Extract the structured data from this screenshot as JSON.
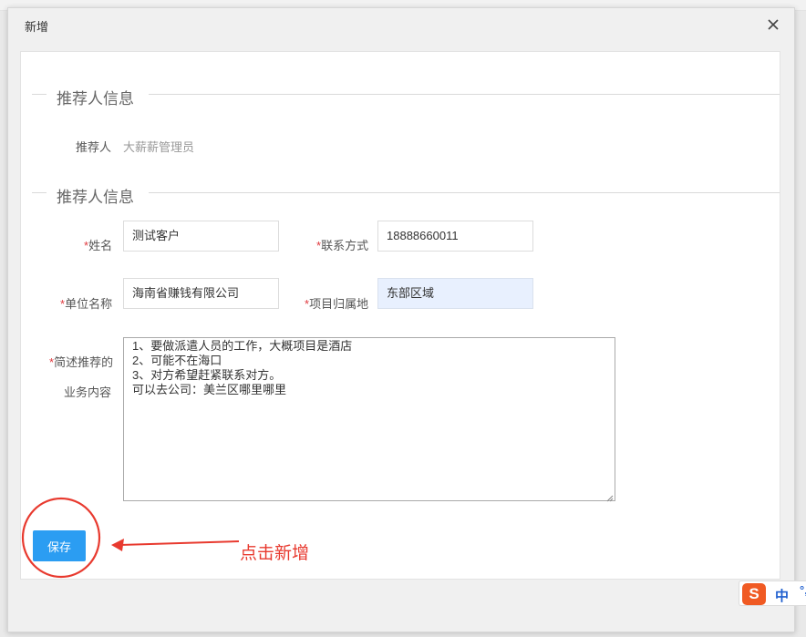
{
  "dialog": {
    "title": "新增"
  },
  "recommender_section": {
    "title": "推荐人信息",
    "recommender_label": "推荐人",
    "recommender_value": "大薪薪管理员"
  },
  "client_section": {
    "title": "推荐人信息",
    "required_mark": "*",
    "name_label": "姓名",
    "name_value": "测试客户",
    "contact_label": "联系方式",
    "contact_value": "18888660011",
    "company_label": "单位名称",
    "company_value": "海南省赚钱有限公司",
    "region_label": "项目归属地",
    "region_value": "东部区域",
    "desc_label_line1": "简述推荐的",
    "desc_label_line2": "业务内容",
    "desc_lines": [
      "1、要做派遣人员的工作，大概项目是酒店",
      "2、可能不在海口",
      "3、对方希望赶紧联系对方。",
      "可以去公司：美兰区哪里哪里"
    ]
  },
  "actions": {
    "save_label": "保存"
  },
  "annotation": {
    "text": "点击新增",
    "color": "#e83a2f"
  },
  "ime": {
    "logo": "S",
    "lang": "中",
    "punct": "°,"
  },
  "colors": {
    "primary_button": "#2b9df2",
    "required": "#e0393e",
    "autofill_bg": "#e8f0fe"
  }
}
